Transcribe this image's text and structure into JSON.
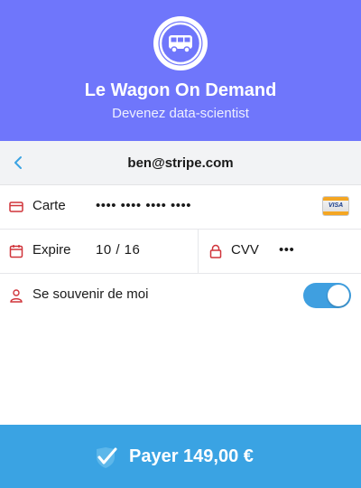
{
  "header": {
    "logo_icon": "bus-icon",
    "title": "Le Wagon On Demand",
    "subtitle": "Devenez data-scientist",
    "background": "#6f76fb"
  },
  "account": {
    "back_icon": "chevron-left-icon",
    "email": "ben@stripe.com"
  },
  "card": {
    "icon": "credit-card-icon",
    "label": "Carte",
    "number_masked": "•••• •••• •••• ••••",
    "brand_badge": "VISA"
  },
  "expiry": {
    "icon": "calendar-icon",
    "label": "Expire",
    "value": "10 / 16"
  },
  "cvv": {
    "icon": "lock-icon",
    "label": "CVV",
    "value_masked": "•••"
  },
  "remember": {
    "icon": "user-icon",
    "label": "Se souvenir de moi",
    "enabled": true
  },
  "pay_button": {
    "icon": "checkmark-icon",
    "label": "Payer 149,00 €",
    "background": "#3aa3e3"
  },
  "accent_icon_color": "#d0343a"
}
